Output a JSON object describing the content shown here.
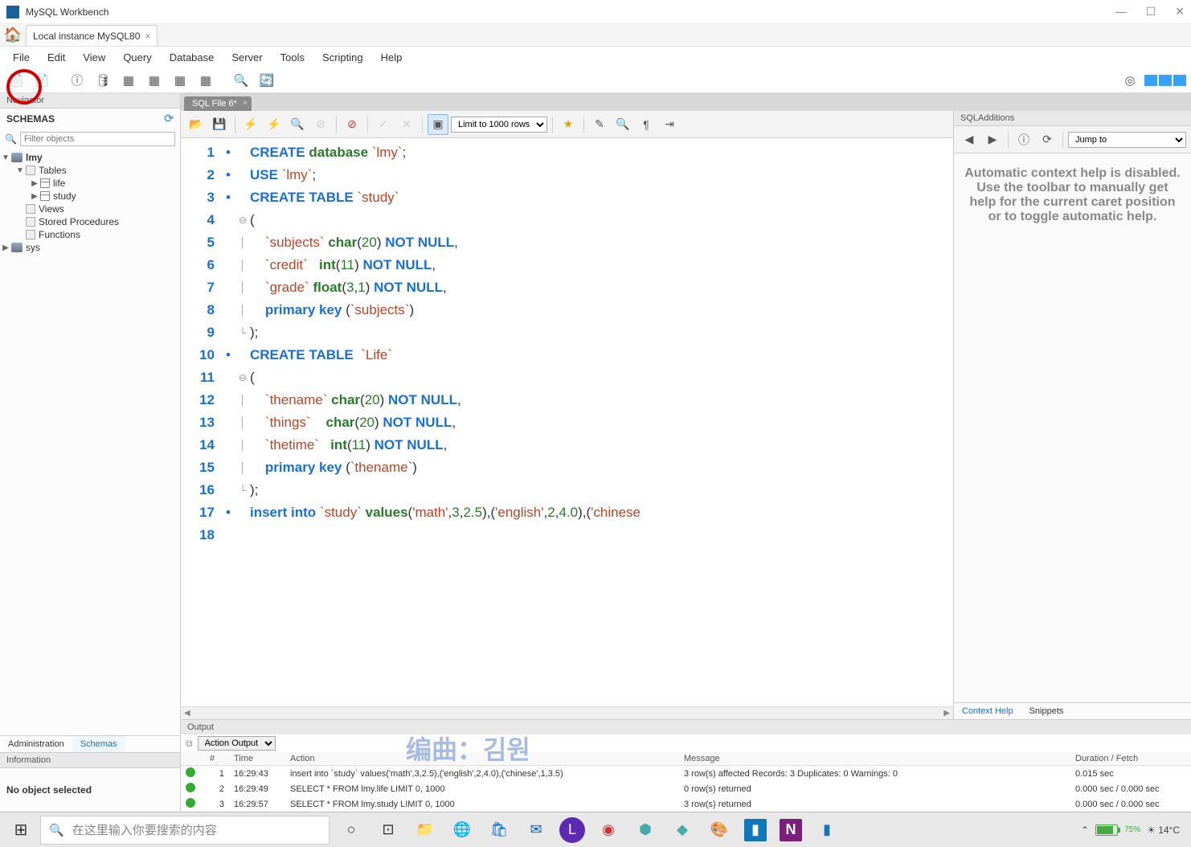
{
  "app": {
    "title": "MySQL Workbench"
  },
  "connection_tab": "Local instance MySQL80",
  "menu": [
    "File",
    "Edit",
    "View",
    "Query",
    "Database",
    "Server",
    "Tools",
    "Scripting",
    "Help"
  ],
  "navigator": {
    "title": "Navigator",
    "section": "SCHEMAS",
    "filter_placeholder": "Filter objects",
    "tree": {
      "schema1": "lmy",
      "tables_label": "Tables",
      "table1": "life",
      "table2": "study",
      "views": "Views",
      "sp": "Stored Procedures",
      "fn": "Functions",
      "schema2": "sys"
    },
    "tabs": {
      "admin": "Administration",
      "schemas": "Schemas"
    },
    "info_hdr": "Information",
    "no_object": "No object selected"
  },
  "file_tab": "SQL File 6*",
  "limit_label": "Limit to 1000 rows",
  "code": {
    "l1": {
      "ln": "1",
      "t": [
        "CREATE",
        " database ",
        "`lmy`",
        ";"
      ]
    },
    "l2": {
      "ln": "2",
      "t": [
        "USE ",
        "`lmy`",
        ";"
      ]
    },
    "l3": {
      "ln": "3",
      "t": [
        "CREATE TABLE ",
        "`study`"
      ]
    },
    "l4": {
      "ln": "4",
      "t": [
        "("
      ]
    },
    "l5": {
      "ln": "5",
      "t": [
        "    ",
        "`subjects`",
        " ",
        "char",
        "(",
        "20",
        ") ",
        "NOT NULL",
        ","
      ]
    },
    "l6": {
      "ln": "6",
      "t": [
        "    ",
        "`credit`",
        "   ",
        "int",
        "(",
        "11",
        ") ",
        "NOT NULL",
        ","
      ]
    },
    "l7": {
      "ln": "7",
      "t": [
        "    ",
        "`grade`",
        " ",
        "float",
        "(",
        "3",
        ",",
        "1",
        ") ",
        "NOT NULL",
        ","
      ]
    },
    "l8": {
      "ln": "8",
      "t": [
        "    ",
        "primary key",
        " (",
        "`subjects`",
        ")"
      ]
    },
    "l9": {
      "ln": "9",
      "t": [
        ");"
      ]
    },
    "l10": {
      "ln": "10",
      "t": [
        "CREATE TABLE  ",
        "`Life`"
      ]
    },
    "l11": {
      "ln": "11",
      "t": [
        "("
      ]
    },
    "l12": {
      "ln": "12",
      "t": [
        "    ",
        "`thename`",
        " ",
        "char",
        "(",
        "20",
        ") ",
        "NOT NULL",
        ","
      ]
    },
    "l13": {
      "ln": "13",
      "t": [
        "    ",
        "`things`",
        "    ",
        "char",
        "(",
        "20",
        ") ",
        "NOT NULL",
        ","
      ]
    },
    "l14": {
      "ln": "14",
      "t": [
        "    ",
        "`thetime`",
        "   ",
        "int",
        "(",
        "11",
        ") ",
        "NOT NULL",
        ","
      ]
    },
    "l15": {
      "ln": "15",
      "t": [
        "    ",
        "primary key",
        " (",
        "`thename`",
        ")"
      ]
    },
    "l16": {
      "ln": "16",
      "t": [
        ");"
      ]
    },
    "l17": {
      "ln": "17",
      "t": [
        "insert into ",
        "`study`",
        " ",
        "values",
        "(",
        "'math'",
        ",",
        "3",
        ",",
        "2.5",
        "),(",
        "'english'",
        ",",
        "2",
        ",",
        "4.0",
        "),(",
        "'chinese"
      ]
    },
    "l18": {
      "ln": "18",
      "t": [
        ""
      ]
    }
  },
  "sqladd": {
    "title": "SQLAdditions",
    "jump": "Jump to",
    "help_msg": "Automatic context help is disabled. Use the toolbar to manually get help for the current caret position or to toggle automatic help.",
    "tabs": {
      "ctx": "Context Help",
      "snip": "Snippets"
    }
  },
  "output": {
    "title": "Output",
    "dropdown": "Action Output",
    "watermark": "编曲：김원",
    "cols": {
      "n": "#",
      "time": "Time",
      "action": "Action",
      "msg": "Message",
      "dur": "Duration / Fetch"
    },
    "rows": [
      {
        "n": "1",
        "time": "16:29:43",
        "action": "insert into `study` values('math',3,2.5),('english',2,4.0),('chinese',1,3.5)",
        "msg": "3 row(s) affected Records: 3  Duplicates: 0  Warnings: 0",
        "dur": "0.015 sec"
      },
      {
        "n": "2",
        "time": "16:29:49",
        "action": "SELECT * FROM lmy.life LIMIT 0, 1000",
        "msg": "0 row(s) returned",
        "dur": "0.000 sec / 0.000 sec"
      },
      {
        "n": "3",
        "time": "16:29:57",
        "action": "SELECT * FROM lmy.study LIMIT 0, 1000",
        "msg": "3 row(s) returned",
        "dur": "0.000 sec / 0.000 sec"
      }
    ]
  },
  "taskbar": {
    "search_placeholder": "在这里输入你要搜索的内容",
    "battery": "75%",
    "weather": "14°C"
  }
}
